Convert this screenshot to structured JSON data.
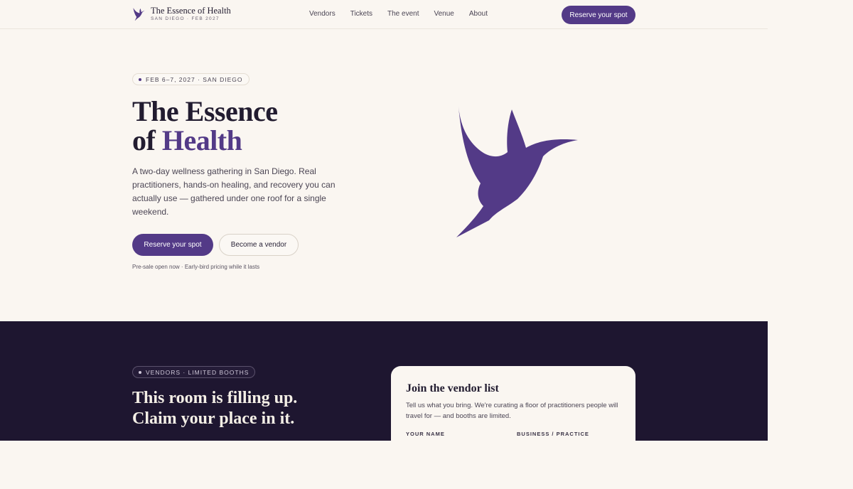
{
  "nav": {
    "brand_name": "The Essence of Health",
    "brand_sub": "SAN DIEGO · FEB 2027",
    "links": [
      "Vendors",
      "Tickets",
      "The event",
      "Venue",
      "About"
    ],
    "cta": "Reserve your spot"
  },
  "hero": {
    "badge": "FEB 6–7, 2027 · SAN DIEGO",
    "title_line1": "The Essence",
    "title_line2_prefix": "of ",
    "title_line2_accent": "Health",
    "description": "A two-day wellness gathering in San Diego. Real practitioners, hands-on healing, and recovery you can actually use — gathered under one roof for a single weekend.",
    "primary_button": "Reserve your spot",
    "secondary_button": "Become a vendor",
    "note": "Pre-sale open now · Early-bird pricing while it lasts"
  },
  "vendors": {
    "badge": "VENDORS · LIMITED BOOTHS",
    "title_line1": "This room is filling up.",
    "title_line2": "Claim your place in it.",
    "card": {
      "title": "Join the vendor list",
      "description": "Tell us what you bring. We're curating a floor of practitioners people will travel for — and booths are limited.",
      "label_name": "YOUR NAME",
      "label_business": "BUSINESS / PRACTICE"
    }
  },
  "colors": {
    "accent": "#533a87",
    "background": "#faf6f1",
    "dark": "#1e1630"
  },
  "icons": {
    "logo": "hummingbird-icon",
    "badge_dot": "dot-icon"
  }
}
